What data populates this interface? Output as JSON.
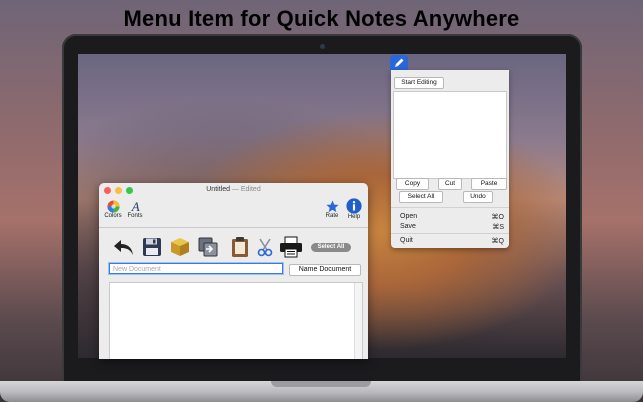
{
  "headline": "Menu Item for Quick Notes Anywhere",
  "menu_panel": {
    "start_editing": "Start Editing",
    "copy": "Copy",
    "cut": "Cut",
    "paste": "Paste",
    "select_all": "Select All",
    "undo": "Undo",
    "menu_items": [
      {
        "label": "Open",
        "shortcut": "⌘O"
      },
      {
        "label": "Save",
        "shortcut": "⌘S"
      },
      {
        "label": "Quit",
        "shortcut": "⌘Q"
      }
    ]
  },
  "window": {
    "title": "Untitled",
    "title_suffix": " — Edited",
    "toolbar": {
      "colors": "Colors",
      "fonts": "Fonts",
      "rate": "Rate",
      "help": "Help"
    },
    "select_all_pill": "Select All",
    "doc_name_placeholder": "New Document",
    "name_button": "Name Document"
  },
  "colors": {
    "accent": "#2b67d8",
    "focus_ring": "#3b7be0",
    "close": "#fc605c",
    "minimize": "#fdbc40",
    "zoom": "#34c84a"
  }
}
